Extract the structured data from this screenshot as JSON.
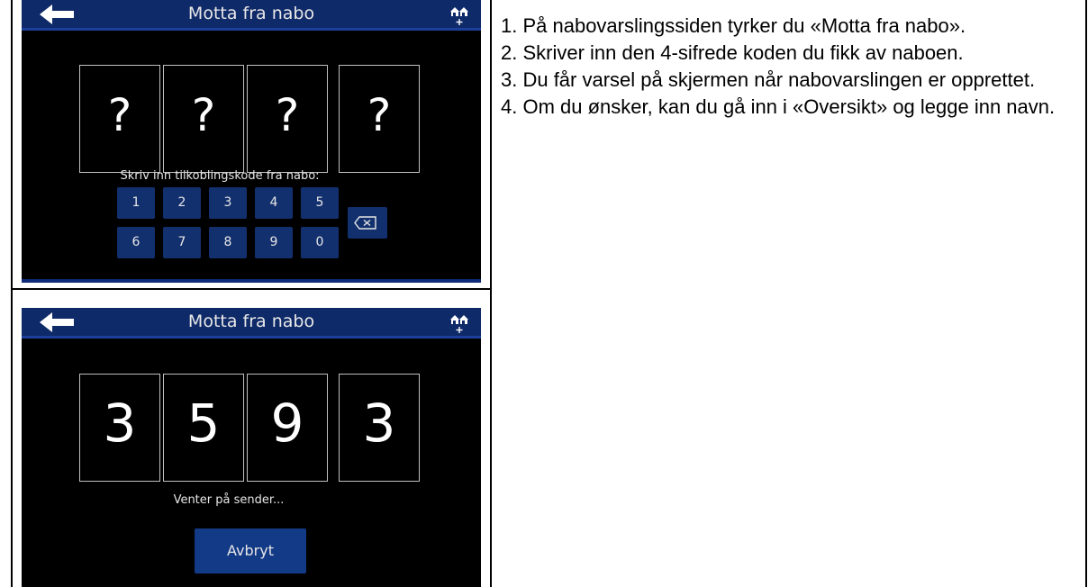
{
  "screen1": {
    "title": "Motta fra nabo",
    "digits": [
      "?",
      "?",
      "?",
      "?"
    ],
    "prompt": "Skriv inn tilkoblingskode fra nabo:",
    "keys_row1": [
      "1",
      "2",
      "3",
      "4",
      "5"
    ],
    "keys_row2": [
      "6",
      "7",
      "8",
      "9",
      "0"
    ],
    "icons": {
      "back": "arrow-left-icon",
      "neighbor": "neighbor-add-icon",
      "backspace": "backspace-icon"
    }
  },
  "screen2": {
    "title": "Motta fra nabo",
    "digits": [
      "3",
      "5",
      "9",
      "3"
    ],
    "status": "Venter på sender...",
    "cancel_label": "Avbryt"
  },
  "instructions": [
    "1. På nabovarslingssiden tyrker du «Motta fra nabo».",
    "2. Skriver inn den 4-sifrede koden du fikk av naboen.",
    "3. Du får varsel på skjermen når nabovarslingen er opprettet.",
    "4. Om du ønsker, kan du gå inn i «Oversikt» og legge inn navn."
  ],
  "colors": {
    "titlebar": "#0f2a68",
    "key": "#13306e",
    "screen_bg": "#000000"
  }
}
